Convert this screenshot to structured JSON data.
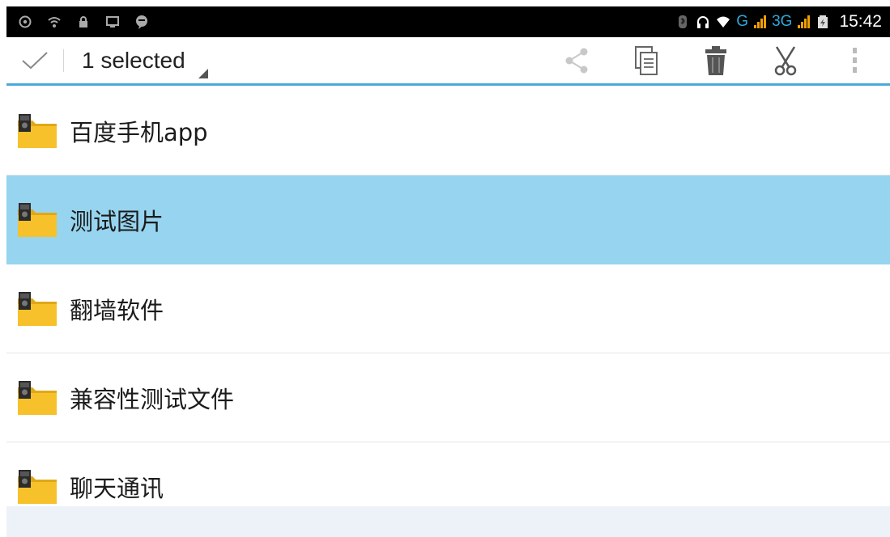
{
  "status_bar": {
    "network_g": "G",
    "network_3g": "3G",
    "time": "15:42"
  },
  "action_bar": {
    "title": "1 selected",
    "accent_color": "#4aa9dc"
  },
  "files": [
    {
      "name": "百度手机app",
      "selected": false
    },
    {
      "name": "测试图片",
      "selected": true
    },
    {
      "name": "翻墙软件",
      "selected": false
    },
    {
      "name": "兼容性测试文件",
      "selected": false
    },
    {
      "name": "聊天通讯",
      "selected": false
    }
  ],
  "colors": {
    "selected_row": "#96d4ef",
    "folder": "#f6c12a",
    "signal": "#f0a000",
    "network_text": "#2fa8d9"
  }
}
